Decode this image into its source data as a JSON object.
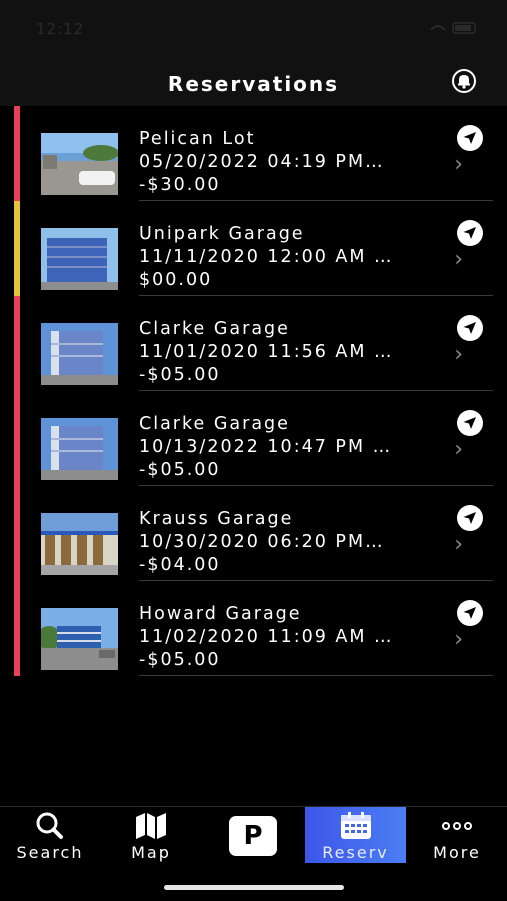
{
  "status_bar": {
    "time": "12:12"
  },
  "header": {
    "title": "Reservations",
    "icon": "bell-icon"
  },
  "reservations": [
    {
      "name": "Pelican Lot",
      "datetime": "05/20/2022 04:19 PM…",
      "amount": "-$30.00",
      "status_color": "#e8405a"
    },
    {
      "name": "Unipark Garage",
      "datetime": "11/11/2020 12:00 AM …",
      "amount": "$00.00",
      "status_color": "#e3c43a"
    },
    {
      "name": "Clarke Garage",
      "datetime": "11/01/2020 11:56 AM …",
      "amount": "-$05.00",
      "status_color": "#e8405a"
    },
    {
      "name": "Clarke Garage",
      "datetime": "10/13/2022 10:47 PM …",
      "amount": "-$05.00",
      "status_color": "#e8405a"
    },
    {
      "name": "Krauss Garage",
      "datetime": "10/30/2020 06:20 PM…",
      "amount": "-$04.00",
      "status_color": "#e8405a"
    },
    {
      "name": "Howard Garage",
      "datetime": "11/02/2020 11:09 AM …",
      "amount": "-$05.00",
      "status_color": "#e8405a"
    }
  ],
  "tabbar": {
    "search": "Search",
    "map": "Map",
    "park": "P",
    "reserv": "Reserv",
    "more": "More",
    "active_color": "#4466ee"
  }
}
